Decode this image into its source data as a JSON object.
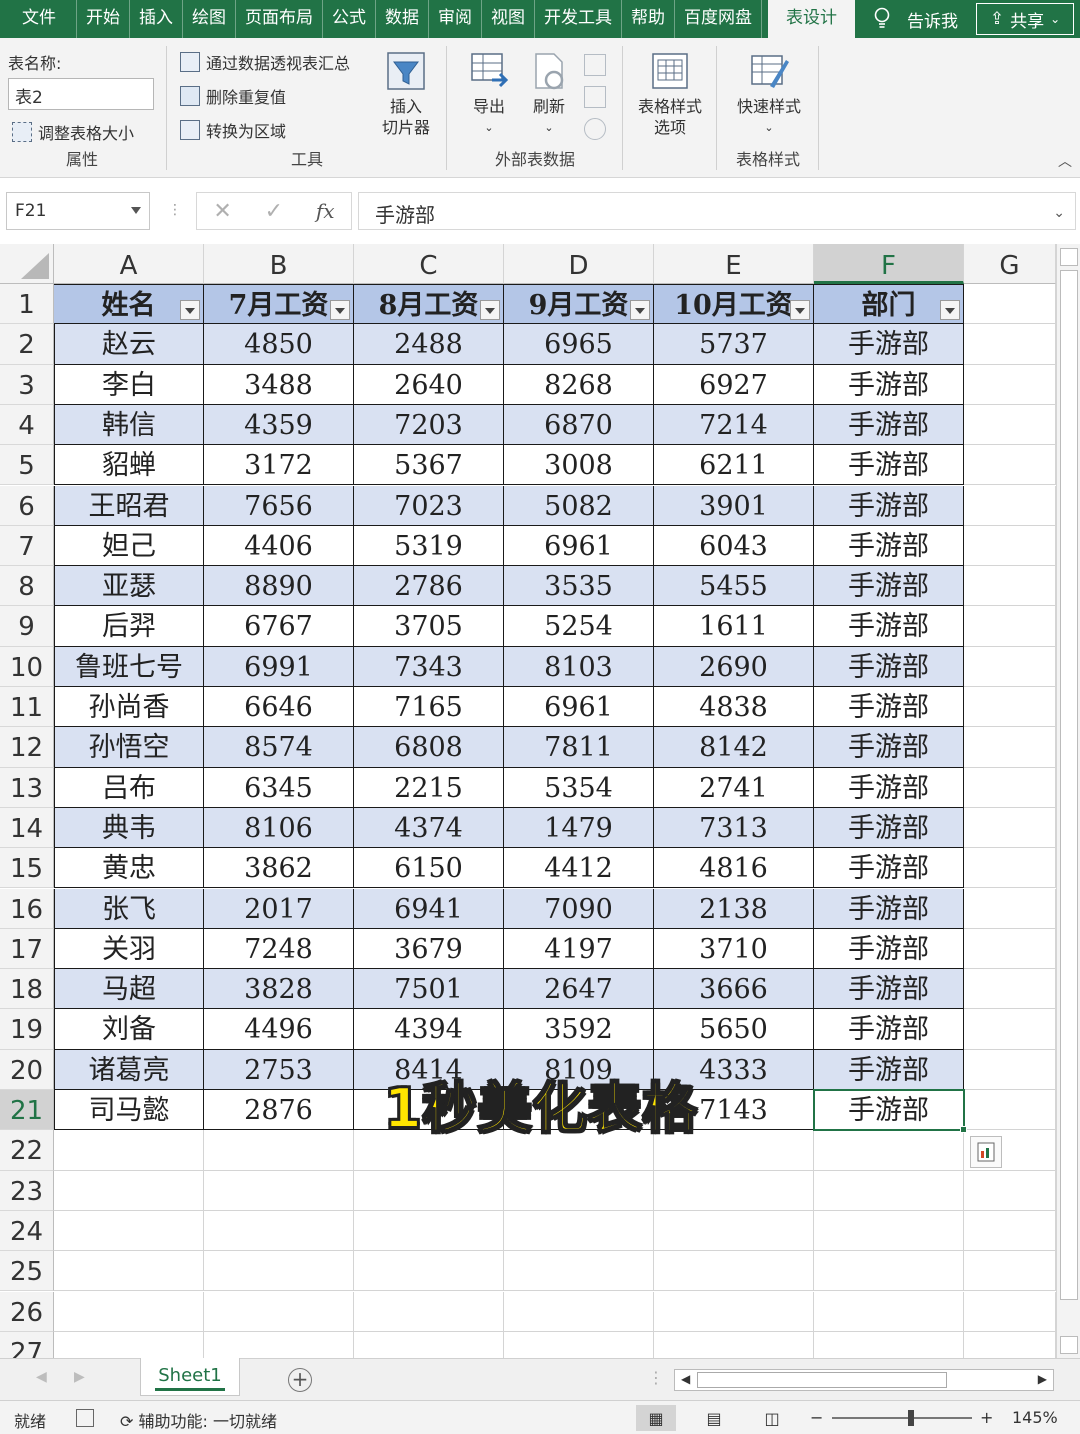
{
  "ribbon_tabs": [
    "文件",
    "开始",
    "插入",
    "绘图",
    "页面布局",
    "公式",
    "数据",
    "审阅",
    "视图",
    "开发工具",
    "帮助",
    "百度网盘",
    "表设计"
  ],
  "active_tab": "表设计",
  "tell_me": "告诉我",
  "share_label": "共享",
  "groups": {
    "properties": {
      "label": "属性",
      "table_name_label": "表名称:",
      "table_name_value": "表2",
      "resize_label": "调整表格大小"
    },
    "tools": {
      "label": "工具",
      "pivot_label": "通过数据透视表汇总",
      "remove_dup_label": "删除重复值",
      "convert_label": "转换为区域",
      "slicer_label_1": "插入",
      "slicer_label_2": "切片器"
    },
    "external": {
      "label": "外部表数据",
      "export_label": "导出",
      "refresh_label": "刷新"
    },
    "style_options": {
      "label_1": "表格样式",
      "label_2": "选项"
    },
    "styles": {
      "label": "表格样式",
      "quick_label": "快速样式"
    }
  },
  "name_box": "F21",
  "formula": "手游部",
  "columns": [
    "A",
    "B",
    "C",
    "D",
    "E",
    "F",
    "G"
  ],
  "selected_column": "F",
  "selected_row": "21",
  "row_numbers": [
    "1",
    "2",
    "3",
    "4",
    "5",
    "6",
    "7",
    "8",
    "9",
    "10",
    "11",
    "12",
    "13",
    "14",
    "15",
    "16",
    "17",
    "18",
    "19",
    "20",
    "21",
    "22",
    "23",
    "24",
    "25",
    "26",
    "27"
  ],
  "table": {
    "headers": [
      "姓名",
      "7月工资",
      "8月工资",
      "9月工资",
      "10月工资",
      "部门"
    ],
    "rows": [
      [
        "赵云",
        "4850",
        "2488",
        "6965",
        "5737",
        "手游部"
      ],
      [
        "李白",
        "3488",
        "2640",
        "8268",
        "6927",
        "手游部"
      ],
      [
        "韩信",
        "4359",
        "7203",
        "6870",
        "7214",
        "手游部"
      ],
      [
        "貂蝉",
        "3172",
        "5367",
        "3008",
        "6211",
        "手游部"
      ],
      [
        "王昭君",
        "7656",
        "7023",
        "5082",
        "3901",
        "手游部"
      ],
      [
        "妲己",
        "4406",
        "5319",
        "6961",
        "6043",
        "手游部"
      ],
      [
        "亚瑟",
        "8890",
        "2786",
        "3535",
        "5455",
        "手游部"
      ],
      [
        "后羿",
        "6767",
        "3705",
        "5254",
        "1611",
        "手游部"
      ],
      [
        "鲁班七号",
        "6991",
        "7343",
        "8103",
        "2690",
        "手游部"
      ],
      [
        "孙尚香",
        "6646",
        "7165",
        "6961",
        "4838",
        "手游部"
      ],
      [
        "孙悟空",
        "8574",
        "6808",
        "7811",
        "8142",
        "手游部"
      ],
      [
        "吕布",
        "6345",
        "2215",
        "5354",
        "2741",
        "手游部"
      ],
      [
        "典韦",
        "8106",
        "4374",
        "1479",
        "7313",
        "手游部"
      ],
      [
        "黄忠",
        "3862",
        "6150",
        "4412",
        "4816",
        "手游部"
      ],
      [
        "张飞",
        "2017",
        "6941",
        "7090",
        "2138",
        "手游部"
      ],
      [
        "关羽",
        "7248",
        "3679",
        "4197",
        "3710",
        "手游部"
      ],
      [
        "马超",
        "3828",
        "7501",
        "2647",
        "3666",
        "手游部"
      ],
      [
        "刘备",
        "4496",
        "4394",
        "3592",
        "5650",
        "手游部"
      ],
      [
        "诸葛亮",
        "2753",
        "8414",
        "8109",
        "4333",
        "手游部"
      ],
      [
        "司马懿",
        "2876",
        "",
        "",
        "7143",
        "手游部"
      ]
    ]
  },
  "caption_overlay": "1秒美化表格",
  "sheet_tab": "Sheet1",
  "status": {
    "ready": "就绪",
    "accessibility": "辅助功能: 一切就绪",
    "zoom": "145%"
  },
  "colors": {
    "excel_green": "#217346",
    "header_fill": "#b4c6e7",
    "band_fill": "#d9e1f2",
    "caption_yellow": "#ffe500"
  }
}
